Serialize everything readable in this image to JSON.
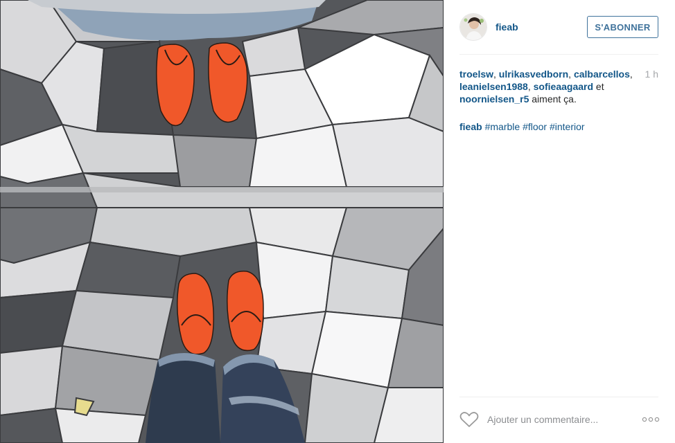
{
  "post": {
    "image_subject": "marble-floor-mirror-photo"
  },
  "header": {
    "username": "fieab",
    "follow_label": "S'ABONNER"
  },
  "likes": {
    "users": [
      "troelsw",
      "ulrikasvedborn",
      "calbarcellos",
      "leanielsen1988",
      "sofieaagaard",
      "noornielsen_r5"
    ],
    "sep1": ", ",
    "sep2": ", ",
    "sep3": ", ",
    "sep4": ", ",
    "and_text": " et ",
    "suffix": " aiment ça.",
    "time": "1 h"
  },
  "caption": {
    "username": "fieab",
    "hashtags": [
      "#marble",
      "#floor",
      "#interior"
    ]
  },
  "comment": {
    "placeholder": "Ajouter un commentaire...",
    "like_icon": "heart-outline-icon",
    "more_icon": "more-options-icon"
  },
  "colors": {
    "link": "#125688",
    "follow_border": "#3f729b",
    "shoe_orange": "#f0582a",
    "timestamp": "#a5a7aa"
  }
}
